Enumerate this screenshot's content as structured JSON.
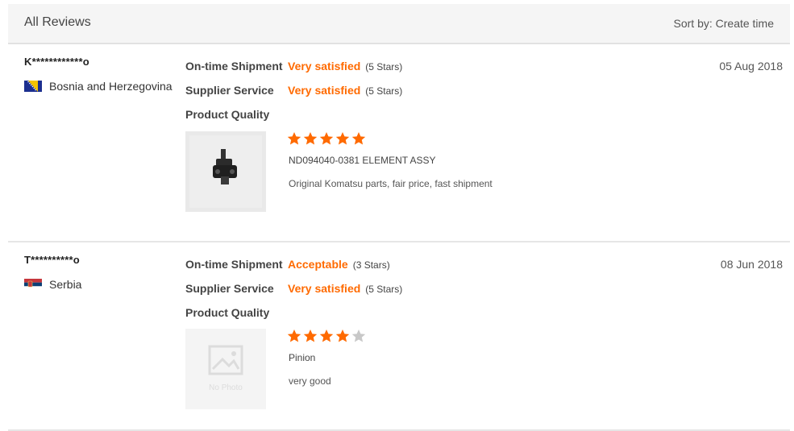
{
  "header": {
    "title": "All Reviews",
    "sort_label": "Sort by: Create time"
  },
  "colors": {
    "accent": "#ff6a00",
    "star_empty": "#c8c8c8"
  },
  "reviews": [
    {
      "user": "K************o",
      "country": "Bosnia and Herzegovina",
      "date": "05 Aug 2018",
      "shipment_label": "On-time Shipment",
      "shipment_value": "Very satisfied",
      "shipment_stars": "(5 Stars)",
      "service_label": "Supplier Service",
      "service_value": "Very satisfied",
      "service_stars": "(5 Stars)",
      "quality_label": "Product Quality",
      "quality_rating": 5,
      "product_name": "ND094040-0381 ELEMENT ASSY",
      "comment": "Original Komatsu parts, fair price, fast shipment"
    },
    {
      "user": "T**********o",
      "country": "Serbia",
      "date": "08 Jun 2018",
      "shipment_label": "On-time Shipment",
      "shipment_value": "Acceptable",
      "shipment_stars": "(3 Stars)",
      "service_label": "Supplier Service",
      "service_value": "Very satisfied",
      "service_stars": "(5 Stars)",
      "quality_label": "Product Quality",
      "quality_rating": 4,
      "product_name": "Pinion",
      "comment": "very good",
      "no_photo_text": "No Photo"
    }
  ]
}
